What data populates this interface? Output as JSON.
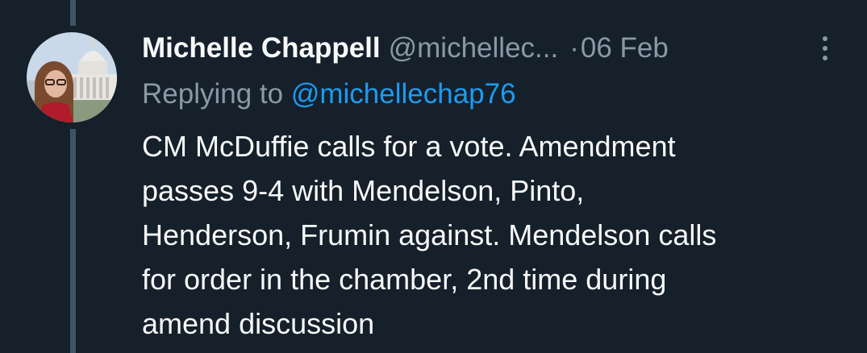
{
  "tweet": {
    "display_name": "Michelle Chappell",
    "handle": "@michellec...",
    "separator": "·",
    "timestamp": "06 Feb",
    "replying_prefix": "Replying to",
    "replying_to": "@michellechap76",
    "text_lines": [
      "CM McDuffie calls for a vote. Amendment",
      "passes 9-4 with Mendelson, Pinto,",
      "Henderson, Frumin against. Mendelson calls",
      "for order in the chamber, 2nd time during",
      "amend discussion"
    ]
  },
  "icons": {
    "more": "more-vertical-icon",
    "avatar": "profile-photo"
  },
  "colors": {
    "background": "#15202b",
    "primary_text": "#f7f9f9",
    "secondary_text": "#8b98a5",
    "link": "#1d9bf0",
    "thread_line": "#3d5466"
  }
}
